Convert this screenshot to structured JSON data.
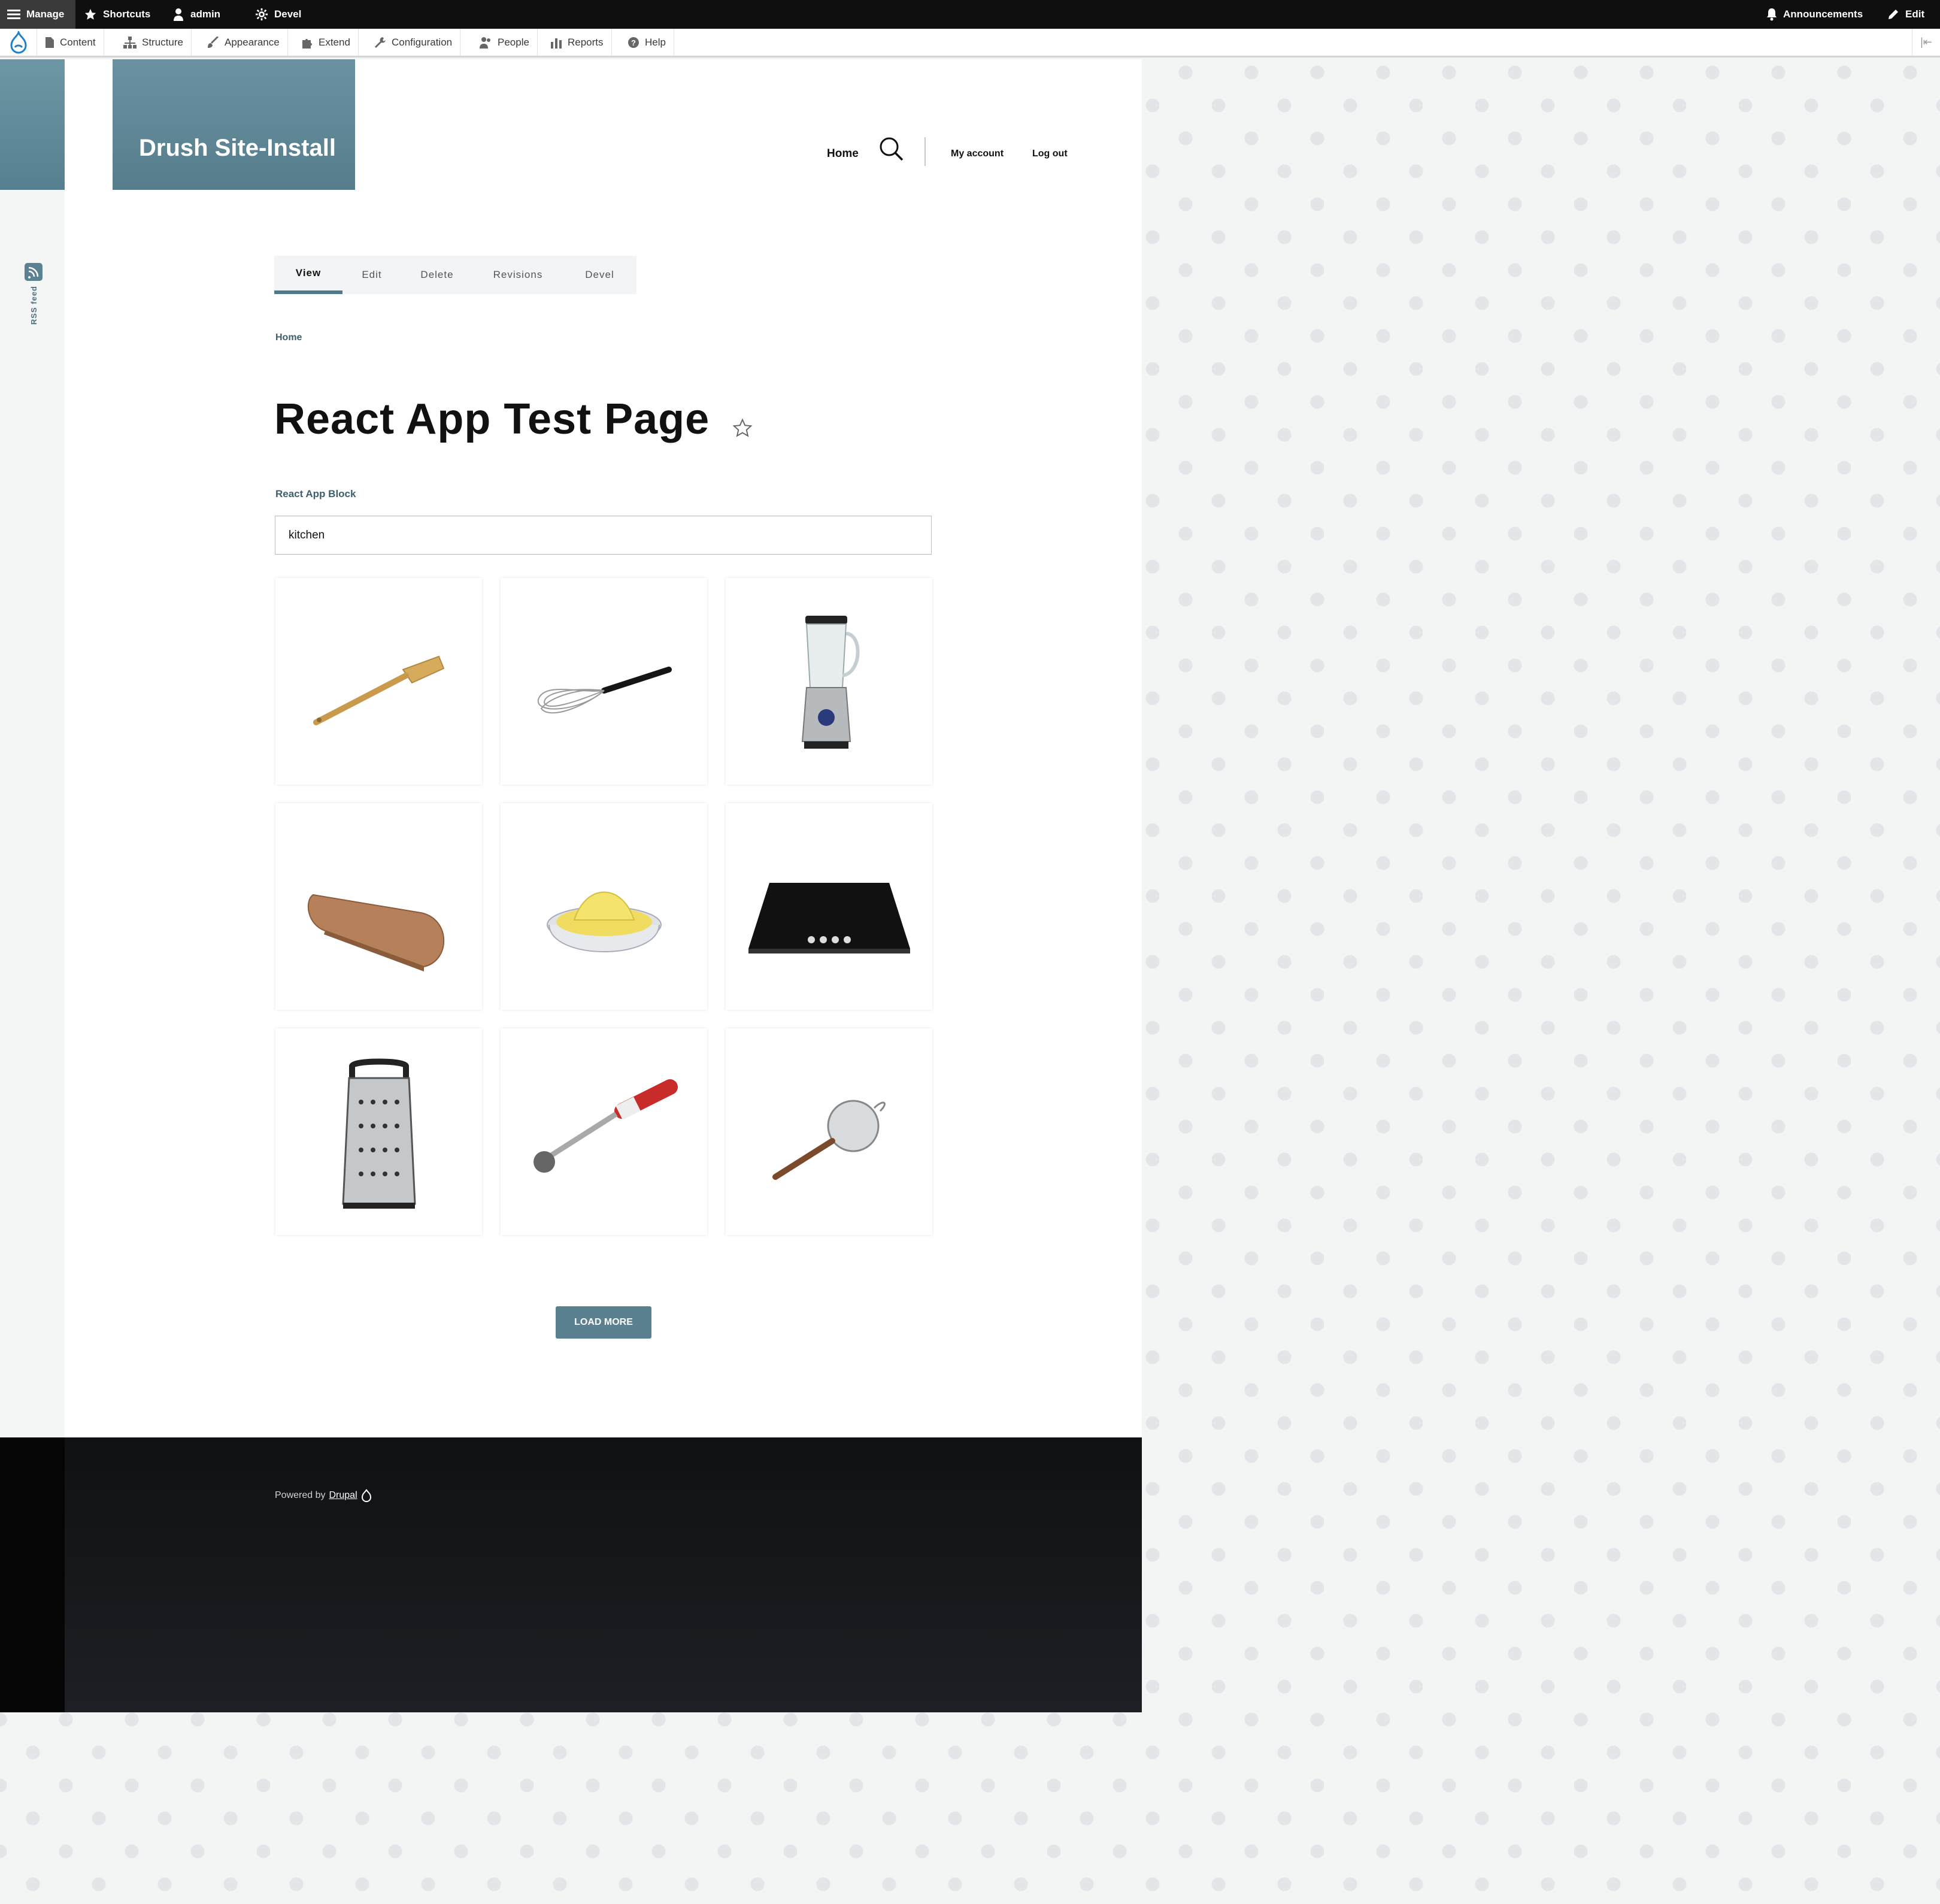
{
  "toolbar": {
    "manage": "Manage",
    "shortcuts": "Shortcuts",
    "user": "admin",
    "devel": "Devel",
    "announcements": "Announcements",
    "edit": "Edit"
  },
  "admin_menu": [
    {
      "label": "Content",
      "icon": "file-icon"
    },
    {
      "label": "Structure",
      "icon": "sitemap-icon"
    },
    {
      "label": "Appearance",
      "icon": "brush-icon"
    },
    {
      "label": "Extend",
      "icon": "puzzle-icon"
    },
    {
      "label": "Configuration",
      "icon": "wrench-icon"
    },
    {
      "label": "People",
      "icon": "people-icon"
    },
    {
      "label": "Reports",
      "icon": "bar-chart-icon"
    },
    {
      "label": "Help",
      "icon": "help-icon"
    }
  ],
  "site": {
    "name": "Drush Site-Install",
    "rss_label": "RSS feed"
  },
  "nav": {
    "home": "Home",
    "my_account": "My account",
    "log_out": "Log out"
  },
  "tabs": [
    "View",
    "Edit",
    "Delete",
    "Revisions",
    "Devel"
  ],
  "breadcrumb": "Home",
  "page_title": "React App Test Page",
  "block": {
    "label": "React App Block",
    "search_value": "kitchen",
    "load_more": "LOAD MORE"
  },
  "products": [
    {
      "icon": "spatula-icon"
    },
    {
      "icon": "whisk-icon"
    },
    {
      "icon": "blender-icon"
    },
    {
      "icon": "cutting-board-icon"
    },
    {
      "icon": "citrus-juicer-icon"
    },
    {
      "icon": "cooktop-icon"
    },
    {
      "icon": "grater-icon"
    },
    {
      "icon": "hand-blender-icon"
    },
    {
      "icon": "strainer-icon"
    }
  ],
  "footer": {
    "powered_by": "Powered by",
    "drupal": "Drupal"
  },
  "colors": {
    "accent": "#5b8191",
    "toolbar": "#0f0f0f",
    "footer": "#15181b"
  }
}
